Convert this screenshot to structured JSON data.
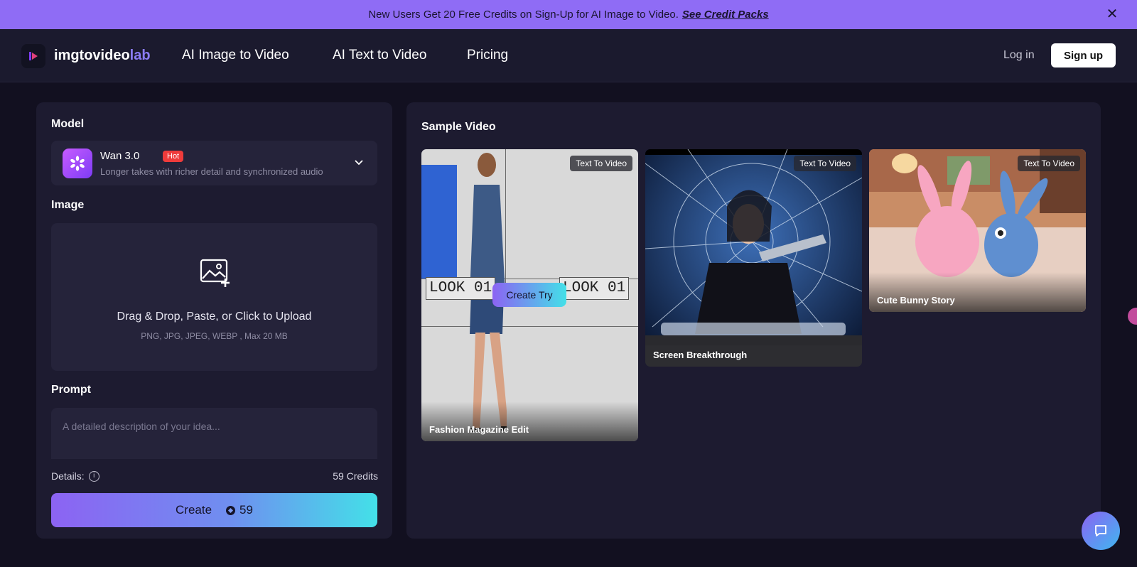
{
  "banner": {
    "text": "New Users Get 20 Free Credits on Sign-Up for AI Image to Video.",
    "link": "See Credit Packs"
  },
  "nav": {
    "brand_main": "imgtovideo",
    "brand_accent": "lab",
    "links": [
      "AI Image to Video",
      "AI Text to Video",
      "Pricing"
    ],
    "login": "Log in",
    "signup": "Sign up"
  },
  "form": {
    "model_label": "Model",
    "model": {
      "name": "Wan 3.0",
      "badge": "Hot",
      "description": "Longer takes with richer detail and synchronized audio"
    },
    "image_label": "Image",
    "upload": {
      "title": "Drag & Drop, Paste, or Click to Upload",
      "hint": "PNG, JPG, JPEG, WEBP , Max 20 MB"
    },
    "prompt_label": "Prompt",
    "prompt_placeholder": "A detailed description of your idea...",
    "details_label": "Details:",
    "credits": "59 Credits",
    "create_label": "Create",
    "create_cost": "59"
  },
  "samples": {
    "title": "Sample Video",
    "cards": [
      {
        "tag": "Text To Video",
        "caption": "Fashion Magazine Edit",
        "overlay": "LOOK 01",
        "action": "Create Try"
      },
      {
        "tag": "Text To Video",
        "caption": "Screen Breakthrough"
      },
      {
        "tag": "Text To Video",
        "caption": "Cute Bunny Story"
      }
    ]
  },
  "colors": {
    "banner": "#8f6cf5",
    "accent": "#8b7cf6",
    "badge_hot": "#ef3b3b",
    "gradient_start": "#8c63f3",
    "gradient_end": "#43e0e8"
  }
}
